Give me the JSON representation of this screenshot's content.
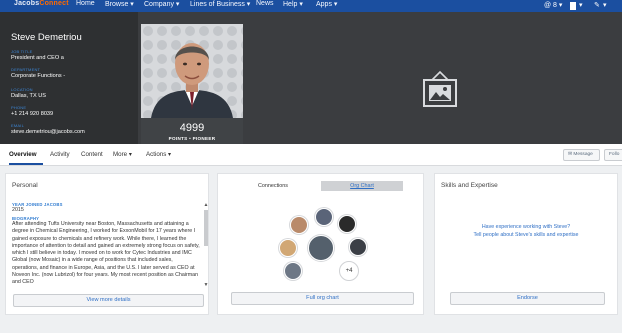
{
  "topnav": {
    "logo_main": "Jacobs",
    "logo_accent": "Connect",
    "items": [
      "Home",
      "Browse ▾",
      "Company ▾",
      "Lines of Business ▾",
      "News",
      "Help ▾",
      "Apps ▾"
    ],
    "right": [
      "@ 8 ▾",
      "▾",
      "▾"
    ]
  },
  "profile": {
    "name": "Steve Demetriou",
    "job_title_label": "JOB TITLE",
    "job_title": "President and CEO a",
    "department_label": "DEPARTMENT",
    "department": "Corporate Functions -",
    "location_label": "LOCATION",
    "location": "Dallas, TX US",
    "phone_label": "PHONE",
    "phone": "+1 214 920 8039",
    "email_label": "EMAIL",
    "email": "steve.demetriou@jacobs.com",
    "points": "4999",
    "points_label": "POINTS • PIONEER"
  },
  "tabs": {
    "overview": "Overview",
    "activity": "Activity",
    "content": "Content",
    "more": "More ▾",
    "actions": "Actions ▾",
    "message": "Message",
    "follow": "Follo"
  },
  "personal": {
    "title": "Personal",
    "year_label": "YEAR JOINED JACOBS",
    "year": "2015",
    "bio_label": "BIOGRAPHY",
    "bio": "After attending Tufts University near Boston, Massachusetts and attaining a degree in Chemical Engineering, I worked for ExxonMobil for 17 years where I gained exposure to chemicals and refinery work. While there, I learned the importance of attention to detail and gained an extremely strong focus on safety, which I still believe in today. I moved on to work for Cytec Industries and IMC Global (now Mosaic) in a wide range of positions that included sales, operations, and finance in Europe, Asia, and the U.S. I later served as CEO at Noveon Inc. (now Lubrizol) for four years. My most recent position as Chairman and CEO",
    "view_more": "View more details"
  },
  "connections": {
    "tab_connections": "Connections",
    "tab_org_chart": "Org Chart",
    "more_count": "+4",
    "full_org": "Full org chart"
  },
  "skills": {
    "title": "Skills and Expertise",
    "prompt_line1": "Have experience working with Steve?",
    "prompt_line2": "Tell people about Steve's skills and expertise",
    "endorse": "Endorse"
  },
  "colors": {
    "nav": "#1b4fa0",
    "header_bg": "#3b3d40",
    "link": "#2f6fc5",
    "label_blue": "#3c86d6"
  }
}
